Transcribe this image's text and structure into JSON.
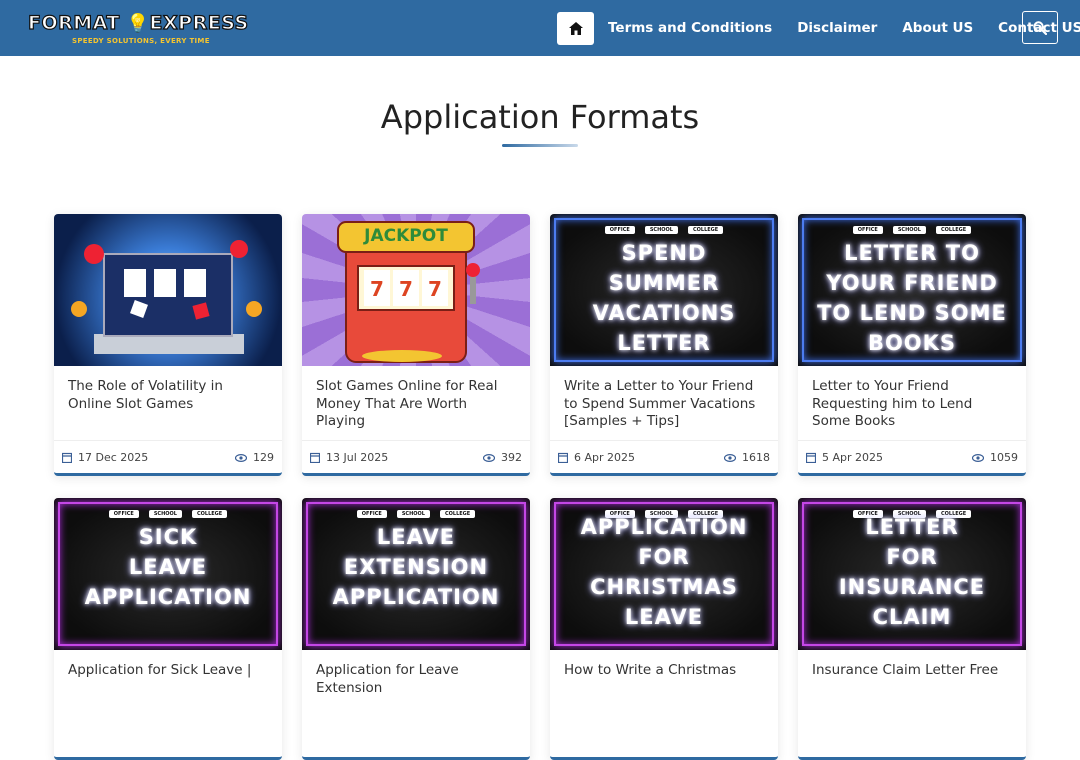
{
  "header": {
    "logo_main": "FORMAT",
    "logo_main2": "EXPRESS",
    "logo_tagline": "SPEEDY SOLUTIONS, EVERY TIME",
    "nav": [
      "Terms and Conditions",
      "Disclaimer",
      "About US",
      "Contact US"
    ],
    "home_icon": "home-icon",
    "search_icon": "search-icon"
  },
  "section": {
    "title": "Application Formats"
  },
  "cards": [
    {
      "title": "The Role of Volatility in Online Slot Games",
      "date": "17 Dec 2025",
      "views": "129"
    },
    {
      "title": "Slot Games Online for Real Money That Are Worth Playing",
      "date": "13 Jul 2025",
      "views": "392",
      "thumb_text": "JACKPOT"
    },
    {
      "title": "Write a Letter to Your Friend to Spend Summer Vacations [Samples + Tips]",
      "date": "6 Apr 2025",
      "views": "1618",
      "thumb_lines": [
        "SPEND",
        "SUMMER",
        "VACATIONS",
        "LETTER"
      ]
    },
    {
      "title": "Letter to Your Friend Requesting him to Lend Some Books",
      "date": "5 Apr 2025",
      "views": "1059",
      "thumb_lines": [
        "LETTER TO",
        "YOUR FRIEND",
        "TO LEND SOME",
        "BOOKS"
      ]
    },
    {
      "title": "Application for Sick Leave |",
      "thumb_lines": [
        "SICK",
        "LEAVE",
        "APPLICATION"
      ]
    },
    {
      "title": "Application for Leave Extension",
      "thumb_lines": [
        "LEAVE",
        "EXTENSION",
        "APPLICATION"
      ]
    },
    {
      "title": "How to Write a Christmas",
      "thumb_lines": [
        "APPLICATION",
        "FOR",
        "CHRISTMAS",
        "LEAVE"
      ]
    },
    {
      "title": "Insurance Claim Letter Free",
      "thumb_lines": [
        "LETTER",
        "FOR",
        "INSURANCE",
        "CLAIM"
      ]
    }
  ],
  "thumb_pills": [
    "OFFICE",
    "SCHOOL",
    "COLLEGE"
  ],
  "colors": {
    "header_bg": "#2f6aa1",
    "accent": "#2f6aa1",
    "neon_purple": "#c447e6",
    "neon_blue": "#4c7cf0"
  }
}
